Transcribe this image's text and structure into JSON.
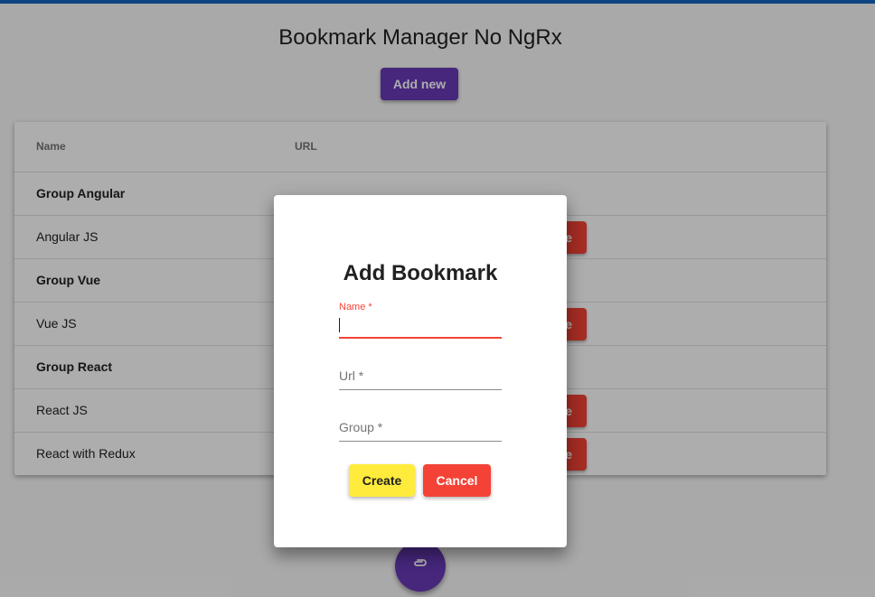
{
  "header": {
    "title": "Bookmark Manager No NgRx",
    "add_new_label": "Add new"
  },
  "table": {
    "columns": [
      "Name",
      "URL"
    ],
    "rows": [
      {
        "type": "group",
        "name": "Group Angular"
      },
      {
        "type": "item",
        "name": "Angular JS",
        "action_label": "e"
      },
      {
        "type": "group",
        "name": "Group Vue"
      },
      {
        "type": "item",
        "name": "Vue JS",
        "action_label": "e"
      },
      {
        "type": "group",
        "name": "Group React"
      },
      {
        "type": "item",
        "name": "React JS",
        "action_label": "e"
      },
      {
        "type": "item",
        "name": "React with Redux",
        "action_label": "e"
      }
    ]
  },
  "fab": {
    "icon": "paperclip-icon"
  },
  "dialog": {
    "title": "Add Bookmark",
    "fields": {
      "name": {
        "label": "Name *",
        "value": ""
      },
      "url": {
        "label": "Url *",
        "value": ""
      },
      "group": {
        "label": "Group *",
        "value": ""
      }
    },
    "create_label": "Create",
    "cancel_label": "Cancel"
  },
  "colors": {
    "primary": "#673ab7",
    "warn": "#f44336",
    "accent": "#ffeb3b",
    "topbar": "#1565c0"
  }
}
